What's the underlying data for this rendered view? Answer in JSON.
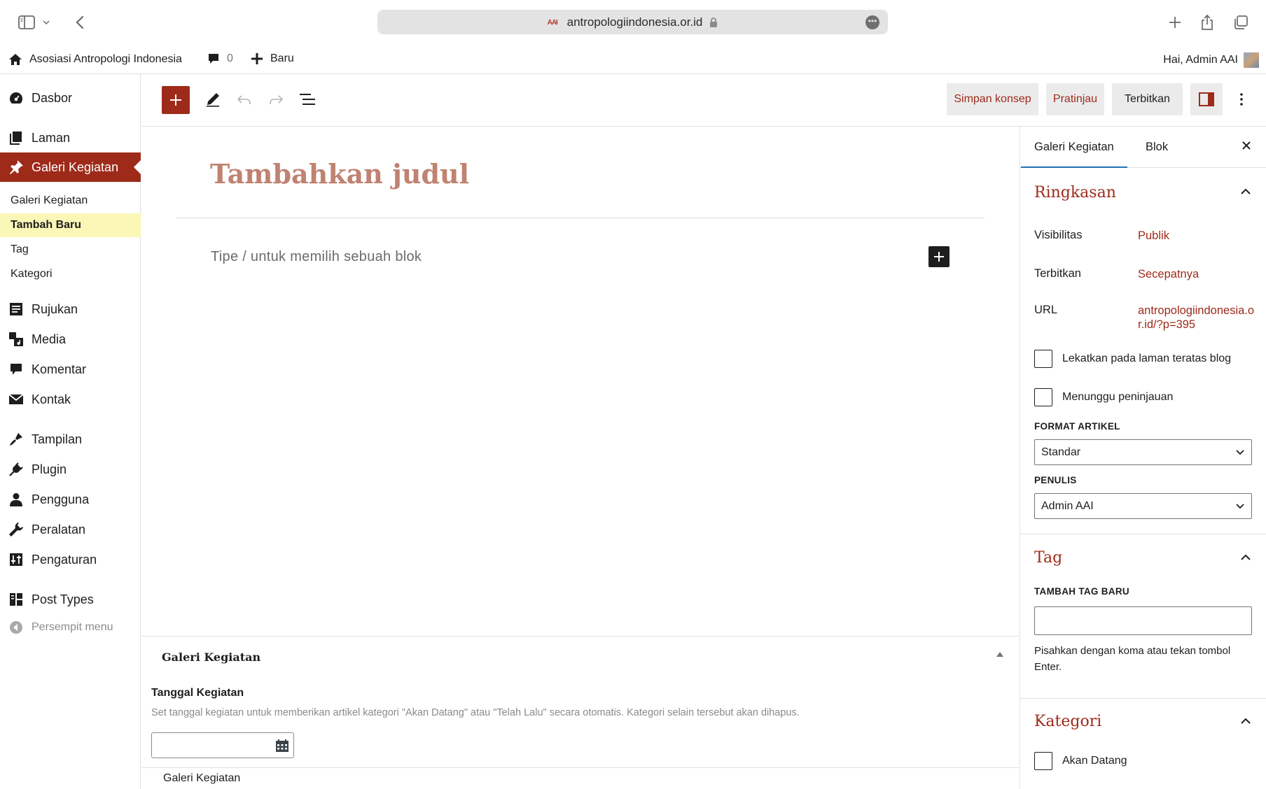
{
  "browser": {
    "url": "antropologiindonesia.or.id",
    "favicon_text": "AAI"
  },
  "admin_bar": {
    "site_name": "Asosiasi Antropologi Indonesia",
    "comments_count": "0",
    "new_label": "Baru",
    "greeting": "Hai, Admin AAI"
  },
  "sidebar": {
    "items": [
      {
        "label": "Dasbor",
        "icon": "dashboard-icon"
      },
      {
        "label": "Laman",
        "icon": "pages-icon"
      },
      {
        "label": "Galeri Kegiatan",
        "icon": "pin-icon"
      },
      {
        "label": "Rujukan",
        "icon": "references-icon"
      },
      {
        "label": "Media",
        "icon": "media-icon"
      },
      {
        "label": "Komentar",
        "icon": "comments-icon"
      },
      {
        "label": "Kontak",
        "icon": "mail-icon"
      },
      {
        "label": "Tampilan",
        "icon": "appearance-icon"
      },
      {
        "label": "Plugin",
        "icon": "plugin-icon"
      },
      {
        "label": "Pengguna",
        "icon": "user-icon"
      },
      {
        "label": "Peralatan",
        "icon": "tools-icon"
      },
      {
        "label": "Pengaturan",
        "icon": "settings-icon"
      },
      {
        "label": "Post Types",
        "icon": "post-types-icon"
      }
    ],
    "submenu": [
      "Galeri Kegiatan",
      "Tambah Baru",
      "Tag",
      "Kategori"
    ],
    "collapse_label": "Persempit menu",
    "active_color": "#9e2a1a"
  },
  "toolbar": {
    "save_draft": "Simpan konsep",
    "preview": "Pratinjau",
    "publish": "Terbitkan"
  },
  "editor": {
    "title_placeholder": "Tambahkan judul",
    "block_placeholder": "Tipe / untuk memilih sebuah blok"
  },
  "metabox": {
    "title": "Galeri Kegiatan",
    "field_label": "Tanggal Kegiatan",
    "field_desc": "Set tanggal kegiatan untuk memberikan artikel kategori \"Akan Datang\" atau \"Telah Lalu\" secara otomatis. Kategori selain tersebut akan dihapus.",
    "date_value": ""
  },
  "footer": {
    "breadcrumb": "Galeri Kegiatan"
  },
  "settings": {
    "tabs": [
      "Galeri Kegiatan",
      "Blok"
    ],
    "summary": {
      "title": "Ringkasan",
      "visibility_label": "Visibilitas",
      "visibility_value": "Publik",
      "publish_label": "Terbitkan",
      "publish_value": "Secepatnya",
      "url_label": "URL",
      "url_value": "antropologiindonesia.or.id/?p=395",
      "sticky_label": "Lekatkan pada laman teratas blog",
      "pending_label": "Menunggu peninjauan",
      "format_label": "FORMAT ARTIKEL",
      "format_value": "Standar",
      "author_label": "PENULIS",
      "author_value": "Admin AAI"
    },
    "tag": {
      "title": "Tag",
      "add_label": "TAMBAH TAG BARU",
      "input_value": "",
      "help": "Pisahkan dengan koma atau tekan tombol Enter."
    },
    "category": {
      "title": "Kategori",
      "first_option": "Akan Datang"
    }
  }
}
